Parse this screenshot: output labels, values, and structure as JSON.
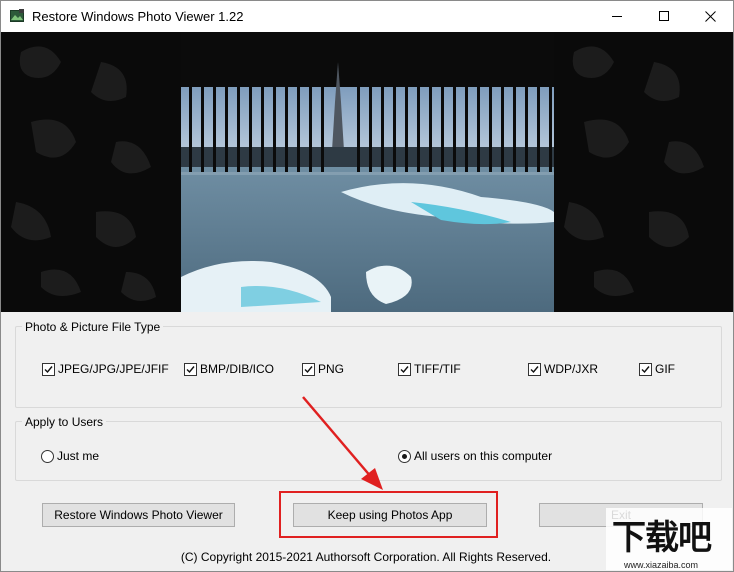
{
  "window": {
    "title": "Restore Windows Photo Viewer 1.22"
  },
  "file_types": {
    "group_title": "Photo & Picture File Type",
    "items": [
      {
        "label": "JPEG/JPG/JPE/JFIF",
        "checked": true
      },
      {
        "label": "BMP/DIB/ICO",
        "checked": true
      },
      {
        "label": "PNG",
        "checked": true
      },
      {
        "label": "TIFF/TIF",
        "checked": true
      },
      {
        "label": "WDP/JXR",
        "checked": true
      },
      {
        "label": "GIF",
        "checked": true
      }
    ]
  },
  "users": {
    "group_title": "Apply to Users",
    "options": [
      {
        "label": "Just me",
        "selected": false
      },
      {
        "label": "All users on this computer",
        "selected": true
      }
    ]
  },
  "buttons": {
    "restore": "Restore Windows Photo Viewer",
    "keep": "Keep using Photos App",
    "exit": "Exit"
  },
  "footer": {
    "copyright": "(C) Copyright 2015-2021 Authorsoft Corporation. All Rights Reserved."
  },
  "watermark": {
    "text": "下载吧",
    "url": "www.xiazaiba.com"
  },
  "colors": {
    "highlight": "#e02020",
    "arrow": "#e02020",
    "dialog_bg": "#f0f0f0"
  },
  "icons": {
    "app": "photo-viewer-icon",
    "minimize": "minimize-icon",
    "maximize": "maximize-icon",
    "close": "close-icon"
  }
}
